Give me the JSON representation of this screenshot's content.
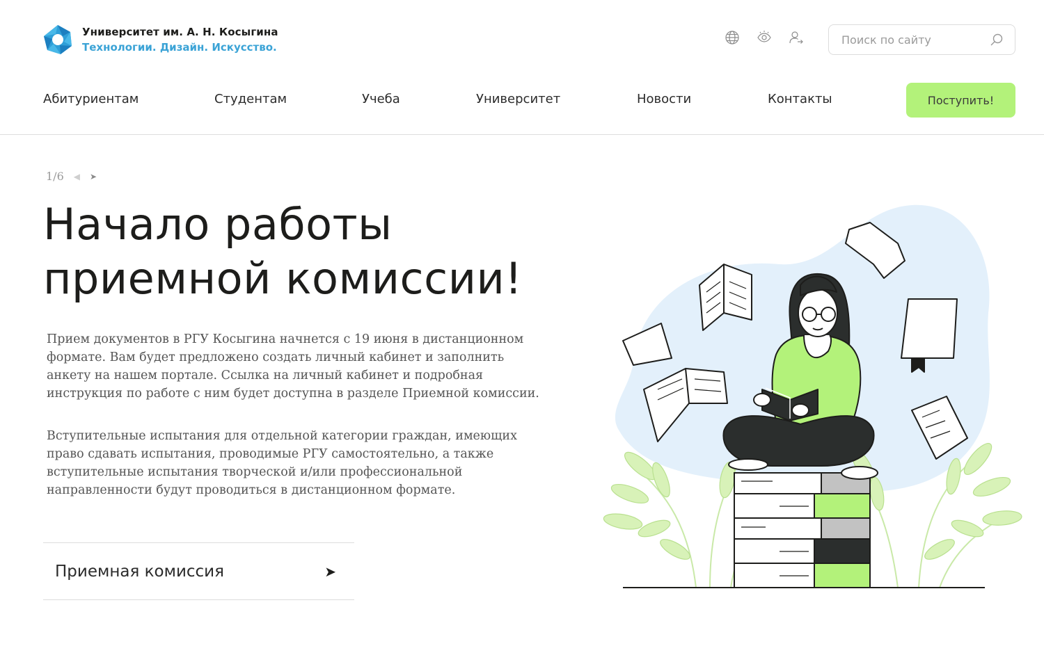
{
  "header": {
    "logo_title": "Университет им. А. Н. Косыгина",
    "logo_subtitle": "Технологии. Дизайн. Искусство.",
    "brand_color": "#3ba3d6",
    "icons": [
      "globe-icon",
      "eye-icon",
      "user-login-icon"
    ],
    "search": {
      "placeholder": "Поиск по сайту",
      "value": ""
    }
  },
  "nav": {
    "items": [
      "Абитуриентам",
      "Студентам",
      "Учеба",
      "Университет",
      "Новости",
      "Контакты"
    ],
    "cta_label": "Поступить!",
    "cta_color": "#b3f27a"
  },
  "slider": {
    "counter": "1/6",
    "prev_icon": "arrow-left-icon",
    "next_icon": "arrow-right-icon"
  },
  "hero": {
    "title_line1": "Начало работы",
    "title_line2": "приемной комиссии!",
    "paragraph1": "Прием документов в РГУ Косыгина начнется с 19 июня в дистанционном формате. Вам будет предложено создать личный кабинет и заполнить анкету на нашем портале. Ссылка на личный кабинет и подробная инструкция по работе с ним будет доступна в разделе Приемной комиссии.",
    "paragraph2": "Вступительные испытания для отдельной категории граждан, имеющих право сдавать испытания, проводимые РГУ самостоятельно, а также вступительные испытания творческой и/или профессиональной направленности будут проводиться в дистанционном формате.",
    "link_label": "Приемная комиссия",
    "accent_color": "#b3f27a",
    "illustration": "woman-reading-on-books-illustration"
  }
}
